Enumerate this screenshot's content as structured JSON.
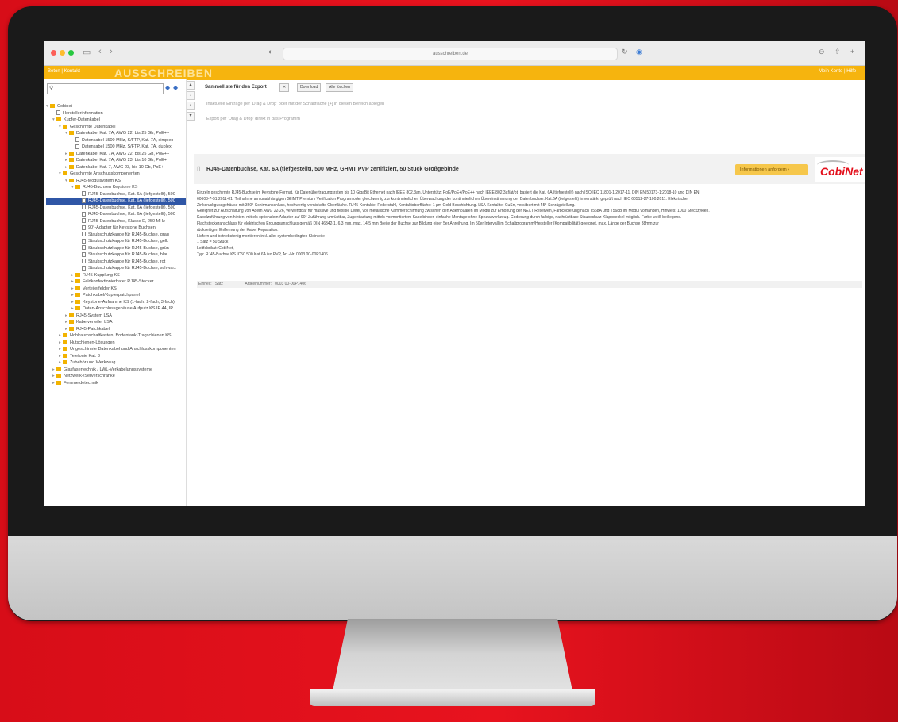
{
  "browser": {
    "url": "ausschreiben.de",
    "nav_back": "‹",
    "nav_forward": "›"
  },
  "yellowbar": {
    "links": "Beton | Kontakt",
    "brand": "AUSSCHREIBEN",
    "right": "Mein Konto | Hilfe"
  },
  "sidebar": {
    "tree": [
      {
        "label": "Cobinet",
        "kind": "folder",
        "level": 0,
        "arrow": "▾"
      },
      {
        "label": "Herstellerinformation",
        "kind": "file",
        "level": 1,
        "arrow": ""
      },
      {
        "label": "Kupfer-Datenkabel",
        "kind": "folder",
        "level": 1,
        "arrow": "▾"
      },
      {
        "label": "Geschirmte Datenkabel",
        "kind": "folder",
        "level": 2,
        "arrow": "▾"
      },
      {
        "label": "Datenkabel Kat. 7A, AWG 22, bis 25 Gb, PoE++",
        "kind": "folder",
        "level": 3,
        "arrow": "▾"
      },
      {
        "label": "Datenkabel 1500 MHz, S/FTP, Kat. 7A, simplex",
        "kind": "file",
        "level": 4,
        "arrow": ""
      },
      {
        "label": "Datenkabel 1500 MHz, S/FTP, Kat. 7A, duplex",
        "kind": "file",
        "level": 4,
        "arrow": ""
      },
      {
        "label": "Datenkabel Kat. 7A, AWG 22, bis 25 Gb, PoE++",
        "kind": "folder",
        "level": 3,
        "arrow": "▸"
      },
      {
        "label": "Datenkabel Kat. 7A, AWG 23, bis 10 Gb, PoE+",
        "kind": "folder",
        "level": 3,
        "arrow": "▸"
      },
      {
        "label": "Datenkabel Kat. 7, AWG 23, bis 10 Gb, PoE+",
        "kind": "folder",
        "level": 3,
        "arrow": "▸"
      },
      {
        "label": "Geschirmte Anschlusskomponenten",
        "kind": "folder",
        "level": 2,
        "arrow": "▾"
      },
      {
        "label": "RJ45-Modulsystem KS",
        "kind": "folder",
        "level": 3,
        "arrow": "▾"
      },
      {
        "label": "RJ45-Buchsen Keystone KS",
        "kind": "folder",
        "level": 4,
        "arrow": "▾"
      },
      {
        "label": "RJ45-Datenbuchse, Kat. 6A (liefgestellt), 500",
        "kind": "file",
        "level": 5,
        "arrow": ""
      },
      {
        "label": "RJ45-Datenbuchse, Kat. 6A (liefgestellt), 500",
        "kind": "file",
        "level": 5,
        "arrow": "",
        "selected": true
      },
      {
        "label": "RJ45-Datenbuchse, Kat. 6A (liefgestellt), 500",
        "kind": "file",
        "level": 5,
        "arrow": ""
      },
      {
        "label": "RJ45-Datenbuchse, Kat. 6A (liefgestellt), 500",
        "kind": "file",
        "level": 5,
        "arrow": ""
      },
      {
        "label": "RJ45-Datenbuchse, Klasse E, 250 MHz",
        "kind": "file",
        "level": 5,
        "arrow": ""
      },
      {
        "label": "90°-Adapter für Keystone Buchsen",
        "kind": "file",
        "level": 5,
        "arrow": ""
      },
      {
        "label": "Staubschutzkappe für RJ45-Buchse, grau",
        "kind": "file",
        "level": 5,
        "arrow": ""
      },
      {
        "label": "Staubschutzkappe für RJ45-Buchse, gelb",
        "kind": "file",
        "level": 5,
        "arrow": ""
      },
      {
        "label": "Staubschutzkappe für RJ45-Buchse, grün",
        "kind": "file",
        "level": 5,
        "arrow": ""
      },
      {
        "label": "Staubschutzkappe für RJ45-Buchse, blau",
        "kind": "file",
        "level": 5,
        "arrow": ""
      },
      {
        "label": "Staubschutzkappe für RJ45-Buchse, rot",
        "kind": "file",
        "level": 5,
        "arrow": ""
      },
      {
        "label": "Staubschutzkappe für RJ45-Buchse, schwarz",
        "kind": "file",
        "level": 5,
        "arrow": ""
      },
      {
        "label": "RJ45-Kupplung KS",
        "kind": "folder",
        "level": 4,
        "arrow": "▸"
      },
      {
        "label": "Feldkonfektionierbarer RJ45-Stecker",
        "kind": "folder",
        "level": 4,
        "arrow": "▸"
      },
      {
        "label": "Verteilerfelder KS",
        "kind": "folder",
        "level": 4,
        "arrow": "▸"
      },
      {
        "label": "Patchkabel/Kupferpatchpanel",
        "kind": "folder",
        "level": 4,
        "arrow": "▸"
      },
      {
        "label": "Keystone-Aufnahme KS (1-fach, 2-fach, 3-fach)",
        "kind": "folder",
        "level": 4,
        "arrow": "▸"
      },
      {
        "label": "Daten-Anschlussgehäuse Aufputz KS IP 44, IP",
        "kind": "folder",
        "level": 4,
        "arrow": "▸"
      },
      {
        "label": "RJ45-System LSA",
        "kind": "folder",
        "level": 3,
        "arrow": "▸"
      },
      {
        "label": "Kabelverteiler LSA",
        "kind": "folder",
        "level": 3,
        "arrow": "▸"
      },
      {
        "label": "RJ45-Patchkabel",
        "kind": "folder",
        "level": 3,
        "arrow": "▸"
      },
      {
        "label": "Hohlraumschaltkasten, Bodentank-Tragschienen KS",
        "kind": "folder",
        "level": 2,
        "arrow": "▸"
      },
      {
        "label": "Hutschienen-Lösungen",
        "kind": "folder",
        "level": 2,
        "arrow": "▸"
      },
      {
        "label": "Ungeschirmte Datenkabel und Anschlusskomponenten",
        "kind": "folder",
        "level": 2,
        "arrow": "▸"
      },
      {
        "label": "Telefonie Kat. 3",
        "kind": "folder",
        "level": 2,
        "arrow": "▸"
      },
      {
        "label": "Zubehör und Werkzeug",
        "kind": "folder",
        "level": 2,
        "arrow": "▸"
      },
      {
        "label": "Glasfasertechnik / LWL-Verkabelungssysteme",
        "kind": "folder",
        "level": 1,
        "arrow": "▸"
      },
      {
        "label": "Netzwerk-/Serverschränke",
        "kind": "folder",
        "level": 1,
        "arrow": "▸"
      },
      {
        "label": "Fernmeldetechnik",
        "kind": "folder",
        "level": 1,
        "arrow": "▸"
      }
    ]
  },
  "collect": {
    "title": "Sammelliste für den Export",
    "btn_download": "Download",
    "btn_all": "Alle löschen",
    "hint1": "Inaktuelle Einträge per 'Drag & Drop' oder mit der Schaltfläche [+] in diesen Bereich ablegen",
    "hint2": "Export per 'Drag & Drop' direkt in das Programm"
  },
  "product": {
    "title": "RJ45-Datenbuchse, Kat. 6A (tiefgestellt), 500 MHz, GHMT PVP zertifiziert, 50 Stück Großgebinde",
    "info_button": "Informationen anfordern",
    "logo": "CobiNet",
    "description": [
      "Einzeln geschirmte RJ45-Buchse im Keystone-Format, für Datenübertragungsraten bis 10 GigaBit Ethernet nach IEEE 802.3an, Unterstützt PoE/PoE+/PoE++ nach IEEE 802.3af/at/bt, basiert die Kat. 6A (tiefgestellt) nach ISO/IEC 11801-1:2017-11, DIN EN 50173-1:2018-10 und DIN EN",
      "60603-7-51:2011-01. Teilnahme am unabhängigen GHMT Premium Verification Program oder gleichwertig zur kontinuierlichen Überwachung der kontinuierlichen Übereinstimmung der Datenbuchse. Kat.6A (tiefgestellt) in verstärkt geprüft nach IEC 60512-27-100:2011. Elektrische",
      "Zinkdruckgussgehäuse mit 360°-Schirmanschluss, hochwertig vernickelte Oberfläche. RJ45-Kontakte: Federstahl, Kontaktoberfläche: 1 µm Gold Beschichtung. LSA-Kontakte: CuSn, versilbert mit 45°-Schrägstellung.",
      "Geeignet zur Aufschaltung von Adern AWG 22-26, verwendbar für massive und flexible Leiter, voll metallische Kammerschirmung zwischen den Adernpaaren im Modul zur Erhöhung der NEXT Reserven, Farbcodierung nach T568A und T568B im Modul vorhanden, Hinweis: 1000 Steckzyklen.",
      "Kabelzuführung von hinten, mittels optionalem Adapter auf 90°-Zuführung umrüstbar, Zugentlastung mittels vormontiertem Kabelbinder, einfache Montage ohne Spezialwerkzeug. Codierung durch farbige, nachrüstbare Staubschutz-Klappdeckel möglich. Farbe weiß beiliegend.",
      "Flachsteckeranschluss für elektrischen Erdungsanschluss gemäß DIN 46342-1, 6,3 mm, max. 14,5 mm Breite der Buchse zur Bildung einer 5er Anreihung. Im 50er Intervall im Schaltprogramm/Hersteller (Kompatibilität) geeignet, max. Länge der Buchse 38mm zur",
      "rückseitigen Entfernung der Kabel Reparation.",
      "Liefern und betriebsfertig montieren inkl. aller systembedingten Kleinteile",
      "1 Satz = 50 Stück",
      "Leitfabrikat: CobiNet,",
      "Typ: RJ45-Buchse KS IC50 500 Kat 6A iso PVP, Art.-Nr. 0003 00-00P1406"
    ],
    "meta": "Einheit:   Satz                    Artikelnummer:   0003 00-00P1406"
  }
}
